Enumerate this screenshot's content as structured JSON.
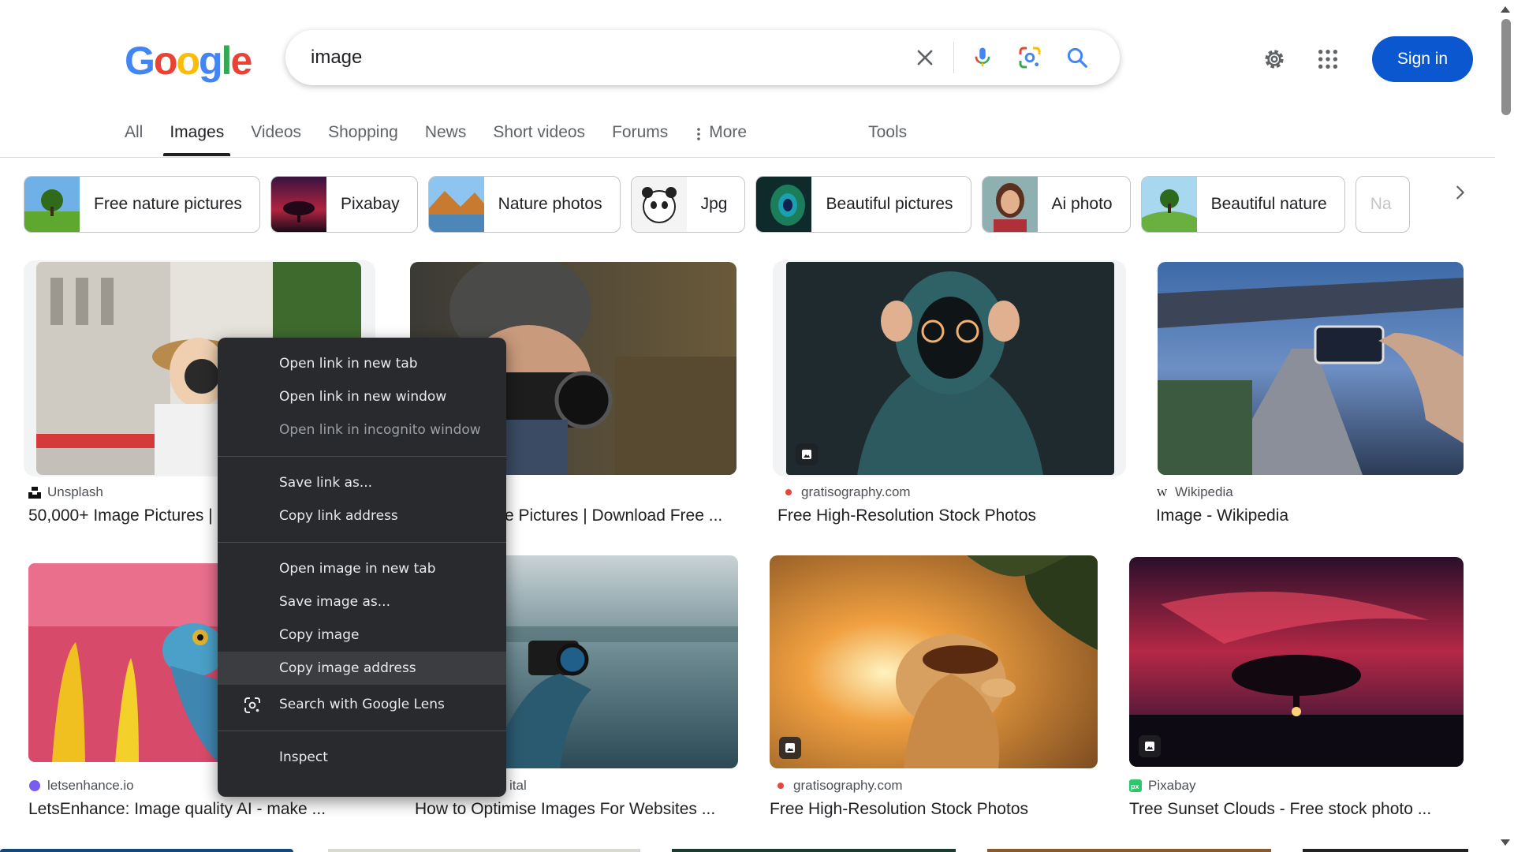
{
  "logo": {
    "text": "Google",
    "letters": [
      "G",
      "o",
      "o",
      "g",
      "l",
      "e"
    ],
    "colors": [
      "#4285F4",
      "#EA4335",
      "#FBBC05",
      "#4285F4",
      "#34A853",
      "#EA4335"
    ]
  },
  "search": {
    "query": "image",
    "clear_icon": "close-icon",
    "voice_icon": "microphone-icon",
    "lens_icon": "google-lens-icon",
    "search_icon": "search-icon"
  },
  "header": {
    "settings_icon": "gear-icon",
    "apps_icon": "apps-grid-icon",
    "sign_in_label": "Sign in"
  },
  "tabs": {
    "items": [
      {
        "label": "All",
        "active": false
      },
      {
        "label": "Images",
        "active": true
      },
      {
        "label": "Videos",
        "active": false
      },
      {
        "label": "Shopping",
        "active": false
      },
      {
        "label": "News",
        "active": false
      },
      {
        "label": "Short videos",
        "active": false
      },
      {
        "label": "Forums",
        "active": false
      }
    ],
    "more_label": "More",
    "tools_label": "Tools"
  },
  "chips": [
    {
      "label": "Free nature pictures"
    },
    {
      "label": "Pixabay"
    },
    {
      "label": "Nature photos"
    },
    {
      "label": "Jpg"
    },
    {
      "label": "Beautiful pictures"
    },
    {
      "label": "Ai photo"
    },
    {
      "label": "Beautiful nature"
    },
    {
      "label": "Na"
    }
  ],
  "results": [
    {
      "source": "Unsplash",
      "title": "50,000+ Image Pictures |"
    },
    {
      "source": "",
      "title": "e Pictures | Download Free ..."
    },
    {
      "source": "gratisography.com",
      "title": "Free High-Resolution Stock Photos"
    },
    {
      "source": "Wikipedia",
      "title": "Image - Wikipedia"
    },
    {
      "source": "letsenhance.io",
      "title": "LetsEnhance: Image quality AI - make ..."
    },
    {
      "source": "ital",
      "title": "How to Optimise Images For Websites ..."
    },
    {
      "source": "gratisography.com",
      "title": "Free High-Resolution Stock Photos"
    },
    {
      "source": "Pixabay",
      "title": "Tree Sunset Clouds - Free stock photo ..."
    }
  ],
  "context_menu": {
    "items": [
      {
        "label": "Open link in new tab"
      },
      {
        "label": "Open link in new window"
      },
      {
        "label": "Open link in incognito window"
      },
      {
        "label": "Save link as..."
      },
      {
        "label": "Copy link address"
      },
      {
        "label": "Open image in new tab"
      },
      {
        "label": "Save image as..."
      },
      {
        "label": "Copy image"
      },
      {
        "label": "Copy image address"
      },
      {
        "label": "Search with Google Lens"
      },
      {
        "label": "Inspect"
      }
    ]
  }
}
